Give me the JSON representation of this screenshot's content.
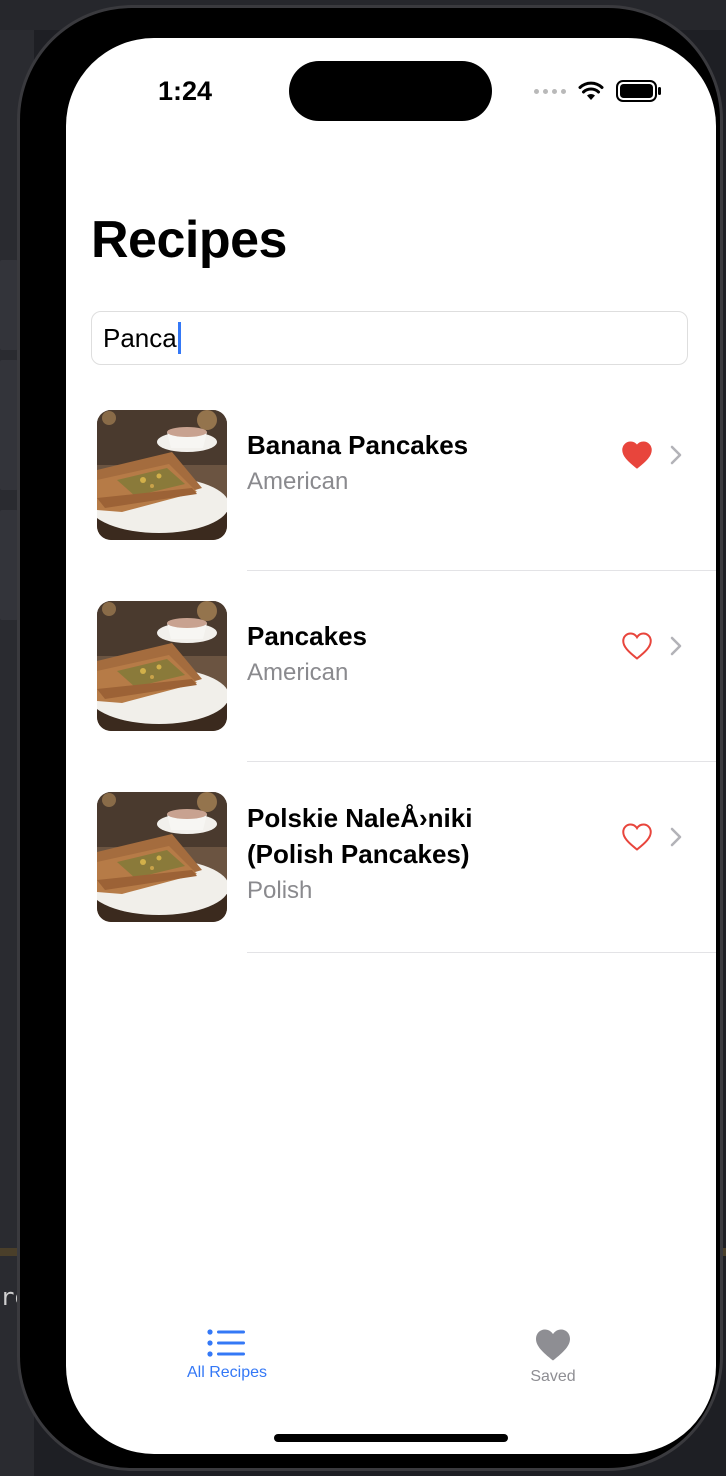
{
  "status_bar": {
    "time": "1:24"
  },
  "header": {
    "title": "Recipes"
  },
  "search": {
    "value": "Panca"
  },
  "recipes": [
    {
      "title_lines": [
        "Banana Pancakes"
      ],
      "cuisine": "American",
      "favorited": true
    },
    {
      "title_lines": [
        "Pancakes"
      ],
      "cuisine": "American",
      "favorited": false
    },
    {
      "title_lines": [
        "Polskie NaleÅ›niki",
        "(Polish Pancakes)"
      ],
      "cuisine": "Polish",
      "favorited": false
    }
  ],
  "tab_bar": {
    "tabs": [
      {
        "label": "All Recipes",
        "icon": "list-icon",
        "selected": true
      },
      {
        "label": "Saved",
        "icon": "heart-icon",
        "selected": false
      }
    ]
  },
  "background": {
    "fragment_text": "re"
  },
  "colors": {
    "accent": "#3478f6",
    "favorite": "#e8453c",
    "secondary_text": "#8a8a8e",
    "inactive_tab": "#8e8e93"
  }
}
